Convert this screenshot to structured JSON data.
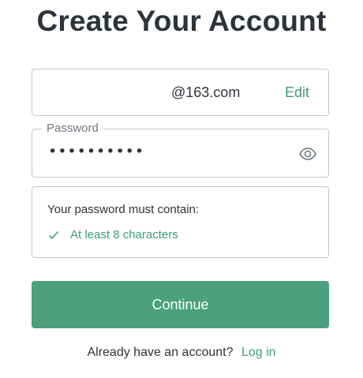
{
  "page": {
    "title": "Create Your Account"
  },
  "email": {
    "value": "@163.com",
    "edit_label": "Edit"
  },
  "password": {
    "label": "Password",
    "value": "••••••••••",
    "toggle_icon": "eye-icon"
  },
  "requirements": {
    "heading": "Your password must contain:",
    "items": [
      {
        "label": "At least 8 characters",
        "met": true,
        "icon": "check-icon"
      }
    ]
  },
  "actions": {
    "continue_label": "Continue"
  },
  "footer": {
    "prompt": "Already have an account?",
    "login_label": "Log in"
  },
  "colors": {
    "accent": "#3d9c78",
    "button": "#4aa07f",
    "text": "#2d333a",
    "border": "#c2c8d0"
  }
}
